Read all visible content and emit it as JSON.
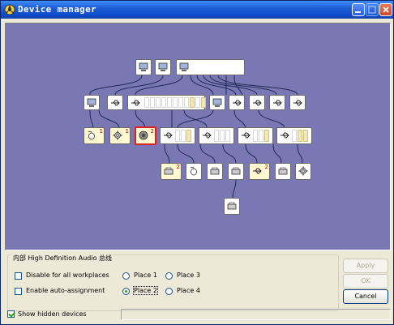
{
  "window": {
    "title": "Device manager"
  },
  "group": {
    "title": "内部 High Definition Audio 总线"
  },
  "options": {
    "disable_all": {
      "label": "Disable for all workplaces",
      "checked": false
    },
    "auto_assign": {
      "label": "Enable auto-assignment",
      "checked": false
    },
    "show_hidden": {
      "label": "Show hidden devices",
      "checked": true
    }
  },
  "places": [
    {
      "label": "Place 1",
      "selected": false
    },
    {
      "label": "Place 3",
      "selected": false
    },
    {
      "label": "Place 2",
      "selected": true
    },
    {
      "label": "Place 4",
      "selected": false
    }
  ],
  "buttons": {
    "apply": "Apply",
    "ok": "OK",
    "cancel": "Cancel"
  },
  "graph": {
    "background": "#7A78B4",
    "badges": [
      "1",
      "1",
      "2",
      "2",
      "2"
    ]
  }
}
